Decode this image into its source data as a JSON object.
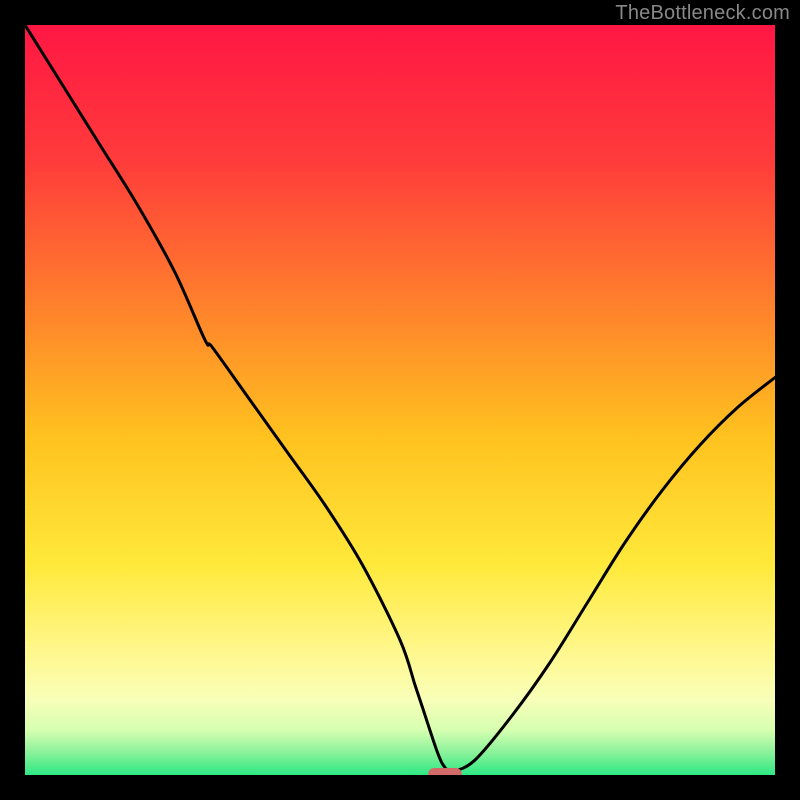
{
  "watermark": "TheBottleneck.com",
  "chart_data": {
    "type": "line",
    "title": "",
    "xlabel": "",
    "ylabel": "",
    "xlim": [
      0,
      100
    ],
    "ylim": [
      0,
      100
    ],
    "grid": false,
    "legend": false,
    "background_gradient_stops": [
      {
        "offset": 0.0,
        "color": "#ff1744"
      },
      {
        "offset": 0.18,
        "color": "#ff3b3b"
      },
      {
        "offset": 0.4,
        "color": "#ff8a2a"
      },
      {
        "offset": 0.55,
        "color": "#ffc21f"
      },
      {
        "offset": 0.72,
        "color": "#ffe93b"
      },
      {
        "offset": 0.84,
        "color": "#fff890"
      },
      {
        "offset": 0.9,
        "color": "#f8ffb8"
      },
      {
        "offset": 0.94,
        "color": "#d6ffb0"
      },
      {
        "offset": 0.97,
        "color": "#8af29a"
      },
      {
        "offset": 1.0,
        "color": "#2de884"
      }
    ],
    "series": [
      {
        "name": "bottleneck-curve",
        "x": [
          0,
          5,
          10,
          15,
          20,
          24,
          25,
          30,
          35,
          40,
          45,
          50,
          52,
          53,
          55,
          56,
          57,
          60,
          65,
          70,
          75,
          80,
          85,
          90,
          95,
          100
        ],
        "values": [
          100,
          92,
          84,
          76,
          67,
          58,
          57,
          50,
          43,
          36,
          28,
          18,
          12,
          9,
          3,
          1,
          0.5,
          2,
          8,
          15,
          23,
          31,
          38,
          44,
          49,
          53
        ]
      }
    ],
    "optimal_point": {
      "x": 56,
      "y": 0,
      "width_pct": 4.5,
      "height_pct": 1.6
    }
  }
}
